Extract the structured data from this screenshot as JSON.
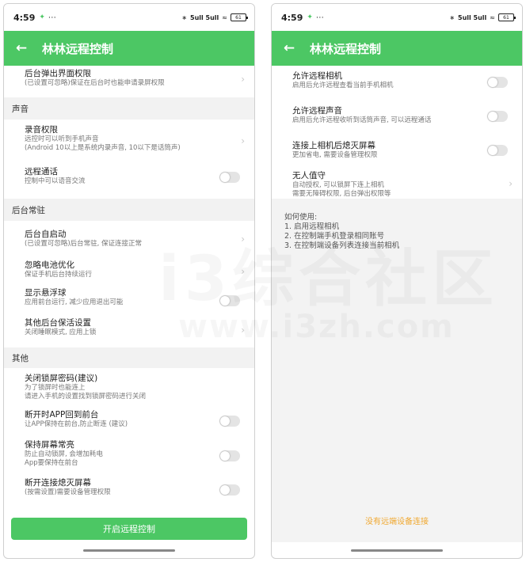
{
  "status": {
    "time": "4:59",
    "battery": "61",
    "signal": "5ull 5ull"
  },
  "appbar": {
    "back_icon": "arrow-left-icon",
    "title": "林林远程控制"
  },
  "left": {
    "items": [
      {
        "title": "后台弹出界面权限",
        "desc": "(已设置可忽略)保证在后台时也能申请录屏权限",
        "control": "chevron"
      },
      {
        "section": "声音"
      },
      {
        "title": "录音权限",
        "desc": "远控时可以听到手机声音\n(Android 10以上是系统内录声音, 10以下是话筒声)",
        "control": "chevron"
      },
      {
        "title": "远程通话",
        "desc": "控制中可以语音交流",
        "control": "toggle",
        "on": false
      },
      {
        "section": "后台常驻"
      },
      {
        "title": "后台自启动",
        "desc": "(已设置可忽略)后台常驻, 保证连接正常",
        "control": "chevron"
      },
      {
        "title": "忽略电池优化",
        "desc": "保证手机后台持续运行",
        "control": "chevron"
      },
      {
        "title": "显示悬浮球",
        "desc": "应用前台运行, 减少应用退出可能",
        "control": "toggle",
        "on": false
      },
      {
        "title": "其他后台保活设置",
        "desc": "关闭睡眠模式, 应用上锁",
        "control": "chevron"
      },
      {
        "section": "其他"
      },
      {
        "title": "关闭锁屏密码(建议)",
        "desc": "为了锁屏时也能连上\n请进入手机的设置找到锁屏密码进行关闭",
        "control": "none"
      },
      {
        "title": "断开时APP回到前台",
        "desc": "让APP保持在前台,防止断连 (建议)",
        "control": "toggle",
        "on": false
      },
      {
        "title": "保持屏幕常亮",
        "desc": "防止自动锁屏, 会增加耗电\nApp要保持在前台",
        "control": "toggle",
        "on": false
      },
      {
        "title": "断开连接熄灭屏幕",
        "desc": "(按需设置)需要设备管理权限",
        "control": "toggle",
        "on": false
      }
    ],
    "button_label": "开启远程控制"
  },
  "right": {
    "items": [
      {
        "title": "允许远程相机",
        "desc": "启用后允许远程查看当前手机相机",
        "control": "toggle",
        "on": false
      },
      {
        "title": "允许远程声音",
        "desc": "启用后允许远程收听到话筒声音, 可以远程通话",
        "control": "toggle",
        "on": false
      },
      {
        "title": "连接上相机后熄灭屏幕",
        "desc": "更加省电, 需要设备管理权限",
        "control": "toggle",
        "on": false
      },
      {
        "title": "无人值守",
        "desc": "自动授权, 可以锁屏下连上相机\n需要无障碍权限, 后台弹出权限等",
        "control": "chevron"
      }
    ],
    "usage": {
      "heading": "如何使用:",
      "steps": [
        "1. 启用远程相机",
        "2. 在控制端手机登录相同账号",
        "3. 在控制端设备列表连接当前相机"
      ]
    },
    "empty_message": "没有远端设备连接"
  },
  "watermark": {
    "main": "i3综合社区",
    "url": "www.i3zh.com"
  },
  "colors": {
    "accent": "#4cc764",
    "warning": "#f0a830",
    "section_bg": "#f2f2f2"
  },
  "icons": {
    "chevron": "chevron-right-icon",
    "toggle": "toggle-switch"
  }
}
